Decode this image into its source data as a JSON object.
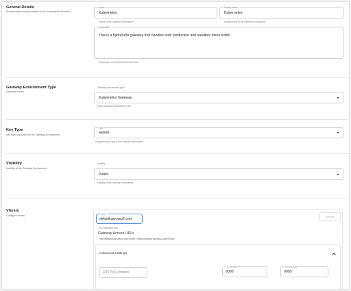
{
  "general": {
    "title": "General Details",
    "desc": "Provide name and description of the Gateway Environment",
    "name": {
      "label": "Name*",
      "value": "Kubernetes",
      "helper": "Name of the Gateway Environment"
    },
    "display_name": {
      "label": "Display Name",
      "value": "Kubernetes",
      "helper": "Display name of the Gateway Environment"
    },
    "description": {
      "label": "Description",
      "value": "This is a hybrid k8s gateway that handles both production and sandbox token traffic.",
      "helper": "Description of the Gateway Environment"
    }
  },
  "env_type": {
    "title": "Gateway Environment Type",
    "desc": "Gateway vendor",
    "label": "Gateway Environment Type*",
    "value": "Kubernetes Gateway",
    "helper": "Select Gateway Environment Type"
  },
  "key_type": {
    "title": "Key Type",
    "desc": "Key type supported by the Gateway Environment",
    "label": "Type",
    "value": "Hybrid",
    "helper": "Supported Key Type of the Gateway Environment"
  },
  "visibility": {
    "title": "Visibility",
    "desc": "Visibility of the Gateway Environment",
    "label": "Visibility",
    "value": "Public",
    "helper": "Visibility of the Gateway Environment"
  },
  "vhosts": {
    "title": "Vhosts",
    "desc": "Configure vhosts",
    "host_label": "Host *",
    "host_value": "default.gw.wso2.com",
    "host_helper": "ex: mgw.wso2.com",
    "remove_label": "Remove",
    "access_title": "Gateway Access URLs",
    "access_urls": "http://default.gw.wso2.com:9090/ | https://default.gw.wso2.com:9095/",
    "advanced": {
      "title": "Advanced Settings",
      "context_placeholder": "HTTP(s) context",
      "http_port_label": "HTTP Port",
      "http_port_value": "9090",
      "https_port_label": "HTTPS Port",
      "https_port_value": "9095"
    }
  }
}
